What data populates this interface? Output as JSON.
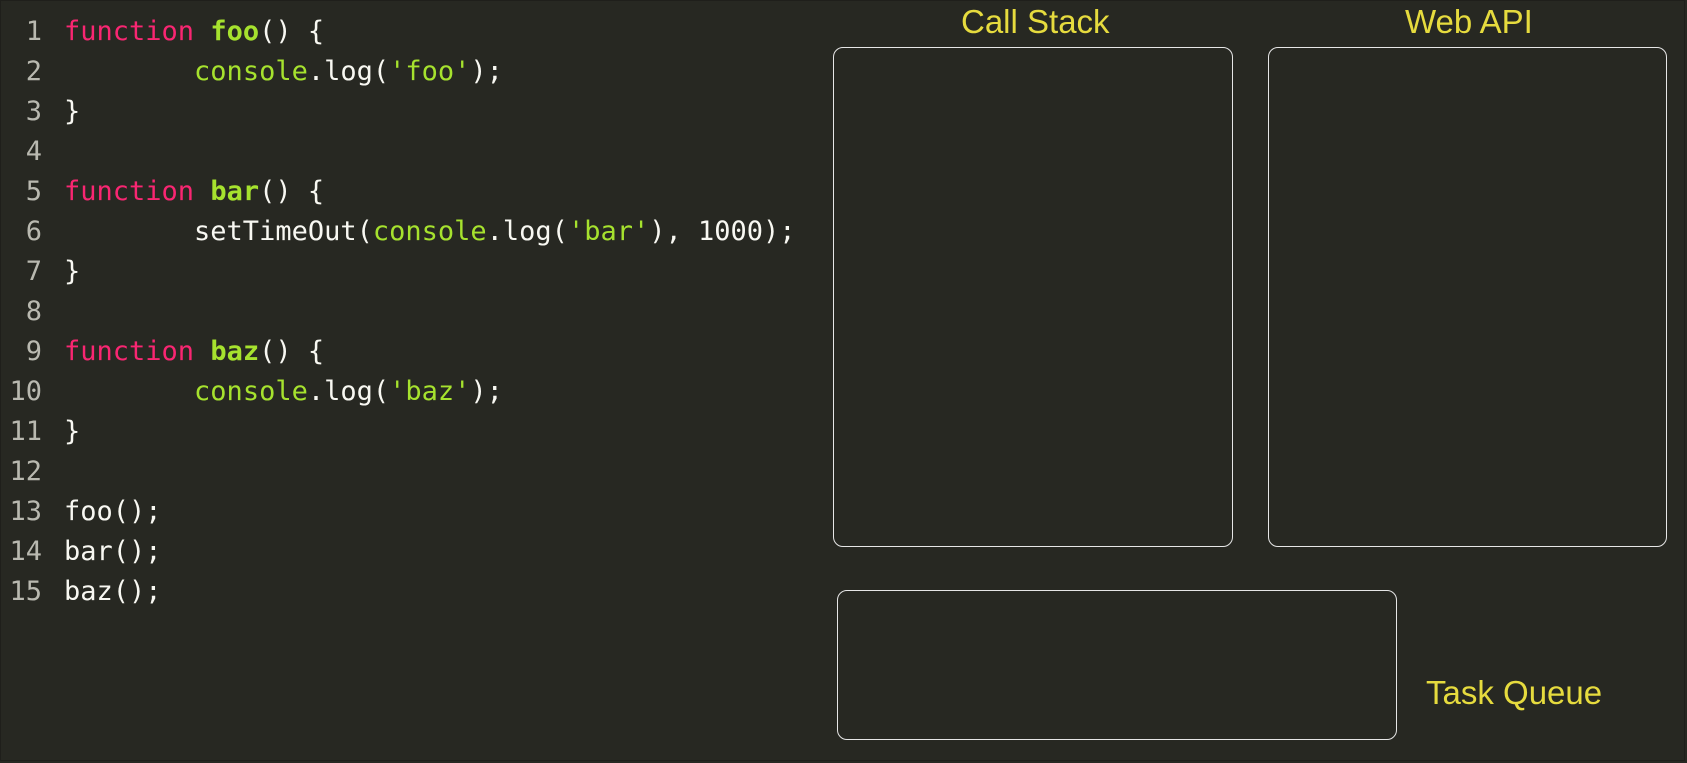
{
  "code": {
    "lines": [
      {
        "num": "1",
        "tokens": [
          {
            "t": "kw",
            "v": "function"
          },
          {
            "t": "plain",
            "v": " "
          },
          {
            "t": "fn",
            "v": "foo"
          },
          {
            "t": "plain",
            "v": "() {"
          }
        ]
      },
      {
        "num": "2",
        "tokens": [
          {
            "t": "plain",
            "v": "        "
          },
          {
            "t": "obj",
            "v": "console"
          },
          {
            "t": "plain",
            "v": ".log("
          },
          {
            "t": "str",
            "v": "'foo'"
          },
          {
            "t": "plain",
            "v": ");"
          }
        ]
      },
      {
        "num": "3",
        "tokens": [
          {
            "t": "plain",
            "v": "}"
          }
        ]
      },
      {
        "num": "4",
        "tokens": []
      },
      {
        "num": "5",
        "tokens": [
          {
            "t": "kw",
            "v": "function"
          },
          {
            "t": "plain",
            "v": " "
          },
          {
            "t": "fn",
            "v": "bar"
          },
          {
            "t": "plain",
            "v": "() {"
          }
        ]
      },
      {
        "num": "6",
        "tokens": [
          {
            "t": "plain",
            "v": "        setTimeOut("
          },
          {
            "t": "obj",
            "v": "console"
          },
          {
            "t": "plain",
            "v": ".log("
          },
          {
            "t": "str",
            "v": "'bar'"
          },
          {
            "t": "plain",
            "v": "), 1000);"
          }
        ]
      },
      {
        "num": "7",
        "tokens": [
          {
            "t": "plain",
            "v": "}"
          }
        ]
      },
      {
        "num": "8",
        "tokens": []
      },
      {
        "num": "9",
        "tokens": [
          {
            "t": "kw",
            "v": "function"
          },
          {
            "t": "plain",
            "v": " "
          },
          {
            "t": "fn",
            "v": "baz"
          },
          {
            "t": "plain",
            "v": "() {"
          }
        ]
      },
      {
        "num": "10",
        "tokens": [
          {
            "t": "plain",
            "v": "        "
          },
          {
            "t": "obj",
            "v": "console"
          },
          {
            "t": "plain",
            "v": ".log("
          },
          {
            "t": "str",
            "v": "'baz'"
          },
          {
            "t": "plain",
            "v": ");"
          }
        ]
      },
      {
        "num": "11",
        "tokens": [
          {
            "t": "plain",
            "v": "}"
          }
        ]
      },
      {
        "num": "12",
        "tokens": []
      },
      {
        "num": "13",
        "tokens": [
          {
            "t": "plain",
            "v": "foo();"
          }
        ]
      },
      {
        "num": "14",
        "tokens": [
          {
            "t": "plain",
            "v": "bar();"
          }
        ]
      },
      {
        "num": "15",
        "tokens": [
          {
            "t": "plain",
            "v": "baz();"
          }
        ]
      }
    ]
  },
  "panels": {
    "call_stack": {
      "label": "Call Stack"
    },
    "web_api": {
      "label": "Web API"
    },
    "task_queue": {
      "label": "Task Queue"
    }
  },
  "colors": {
    "background": "#272822",
    "keyword": "#f92672",
    "function_name": "#a6e22e",
    "string": "#a6e22e",
    "text": "#f8f8f2",
    "line_number": "#b9b9b0",
    "panel_label": "#e6db3e",
    "panel_border": "#e6e6e6"
  }
}
